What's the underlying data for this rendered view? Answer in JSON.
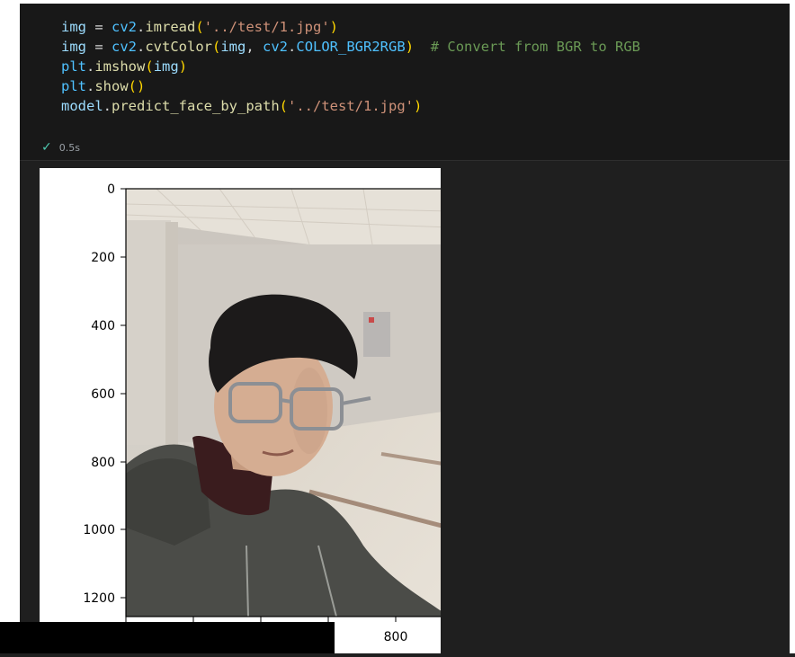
{
  "code_cell": {
    "lines": [
      [
        "img",
        " = ",
        "cv2",
        ".",
        "imread",
        "(",
        "'../test/1.jpg'",
        ")"
      ],
      [
        "img",
        " = ",
        "cv2",
        ".",
        "cvtColor",
        "(",
        "img",
        ", ",
        "cv2",
        ".",
        "COLOR_BGR2RGB",
        ")",
        "  ",
        "# Convert from BGR to RGB"
      ],
      [
        "plt",
        ".",
        "imshow",
        "(",
        "img",
        ")"
      ],
      [
        "plt",
        ".",
        "show",
        "()"
      ],
      [
        "model",
        ".",
        "predict_face_by_path",
        "(",
        "'../test/1.jpg'",
        ")"
      ]
    ]
  },
  "status": {
    "check_icon": "check-icon",
    "time": "0.5s"
  },
  "figure": {
    "y_ticks": [
      "0",
      "200",
      "400",
      "600",
      "800",
      "1000",
      "1200"
    ],
    "x_tick_visible": "800"
  },
  "colors": {
    "background": "#1f1f1f",
    "code_background": "#181818",
    "string": "#ce9178",
    "comment": "#6a9955",
    "function": "#dcdcaa",
    "variable": "#9cdcfe"
  }
}
